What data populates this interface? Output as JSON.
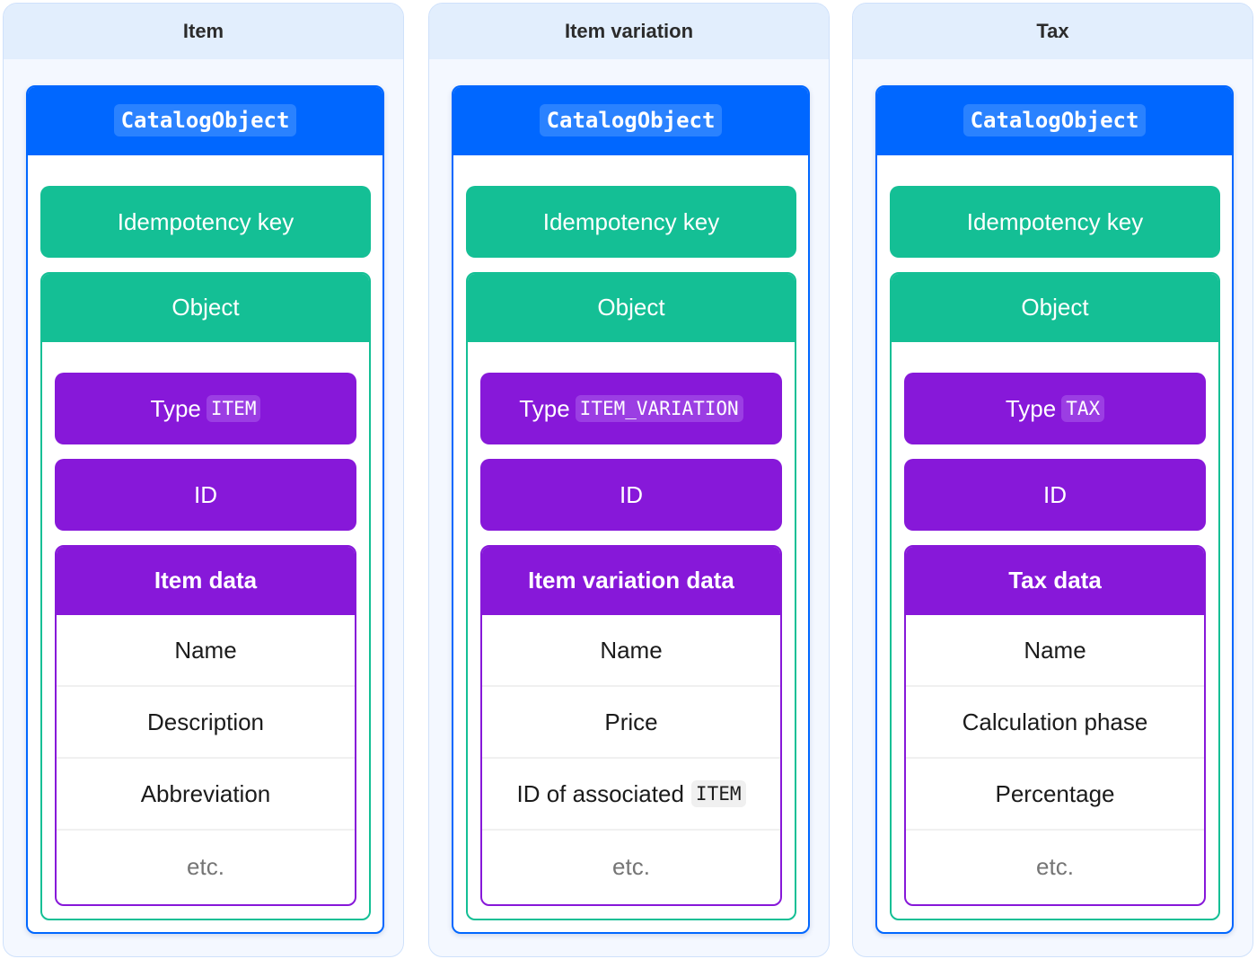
{
  "columns": [
    {
      "title": "Item",
      "catalog_label": "CatalogObject",
      "idempotency_label": "Idempotency key",
      "object_label": "Object",
      "type_label": "Type",
      "type_value": "ITEM",
      "id_label": "ID",
      "data_label": "Item data",
      "fields": [
        {
          "text": "Name",
          "code": null
        },
        {
          "text": "Description",
          "code": null
        },
        {
          "text": "Abbreviation",
          "code": null
        },
        {
          "text": "etc.",
          "code": null,
          "muted": true
        }
      ]
    },
    {
      "title": "Item variation",
      "catalog_label": "CatalogObject",
      "idempotency_label": "Idempotency key",
      "object_label": "Object",
      "type_label": "Type",
      "type_value": "ITEM_VARIATION",
      "id_label": "ID",
      "data_label": "Item variation data",
      "fields": [
        {
          "text": "Name",
          "code": null
        },
        {
          "text": "Price",
          "code": null
        },
        {
          "text": "ID of associated",
          "code": "ITEM"
        },
        {
          "text": "etc.",
          "code": null,
          "muted": true
        }
      ]
    },
    {
      "title": "Tax",
      "catalog_label": "CatalogObject",
      "idempotency_label": "Idempotency key",
      "object_label": "Object",
      "type_label": "Type",
      "type_value": "TAX",
      "id_label": "ID",
      "data_label": "Tax data",
      "fields": [
        {
          "text": "Name",
          "code": null
        },
        {
          "text": "Calculation phase",
          "code": null
        },
        {
          "text": "Percentage",
          "code": null
        },
        {
          "text": "etc.",
          "code": null,
          "muted": true
        }
      ]
    }
  ],
  "colors": {
    "catalog_blue": "#0067ff",
    "object_green": "#14bf95",
    "data_purple": "#8718d9",
    "column_bg": "#f4f8ff",
    "column_header_bg": "#e2eefd"
  }
}
